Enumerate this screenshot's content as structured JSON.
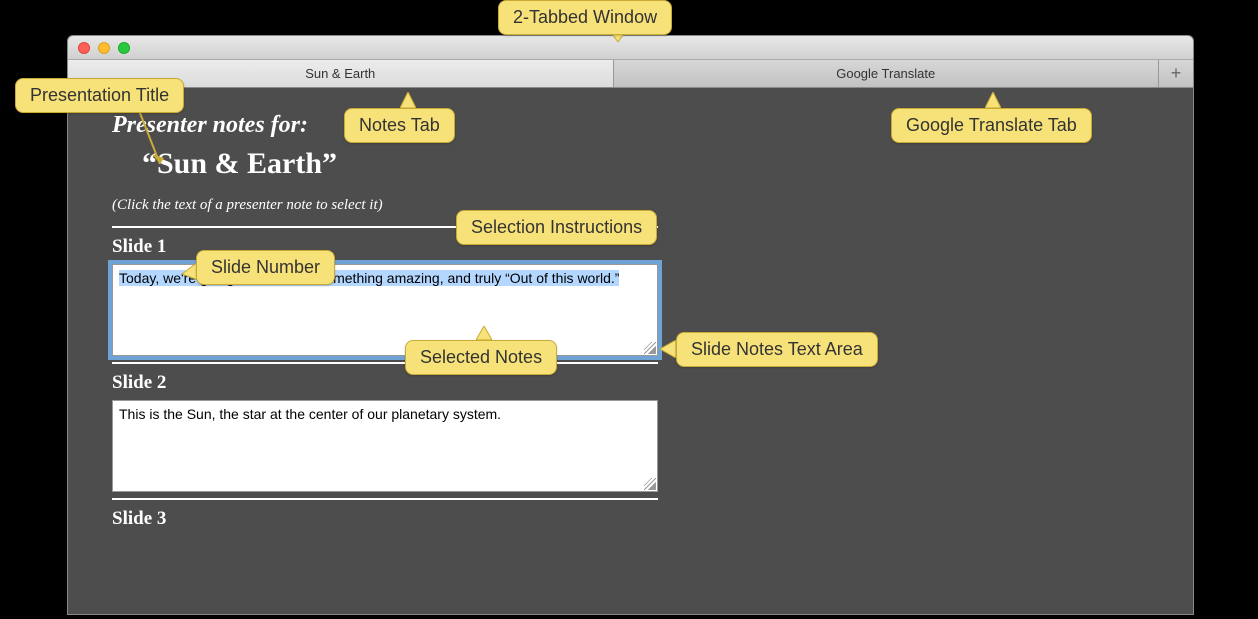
{
  "tabs": {
    "active": "Sun & Earth",
    "inactive": "Google Translate"
  },
  "header": {
    "notes_for": "Presenter notes for:",
    "presentation_title": "“Sun & Earth”",
    "instructions": "(Click the text of a presenter note to select it)"
  },
  "slides": [
    {
      "label": "Slide 1",
      "text": "Today, we're going to talk about something amazing, and truly “Out of this world.”",
      "selected": true
    },
    {
      "label": "Slide 2",
      "text": "This is the Sun, the star at the center of our planetary system.",
      "selected": false
    },
    {
      "label": "Slide 3",
      "text": "",
      "selected": false
    }
  ],
  "callouts": {
    "tabbed_window": "2-Tabbed Window",
    "presentation_title": "Presentation Title",
    "notes_tab": "Notes Tab",
    "google_translate_tab": "Google Translate Tab",
    "selection_instructions": "Selection Instructions",
    "slide_number": "Slide Number",
    "selected_notes": "Selected Notes",
    "slide_notes_text_area": "Slide Notes Text Area"
  }
}
